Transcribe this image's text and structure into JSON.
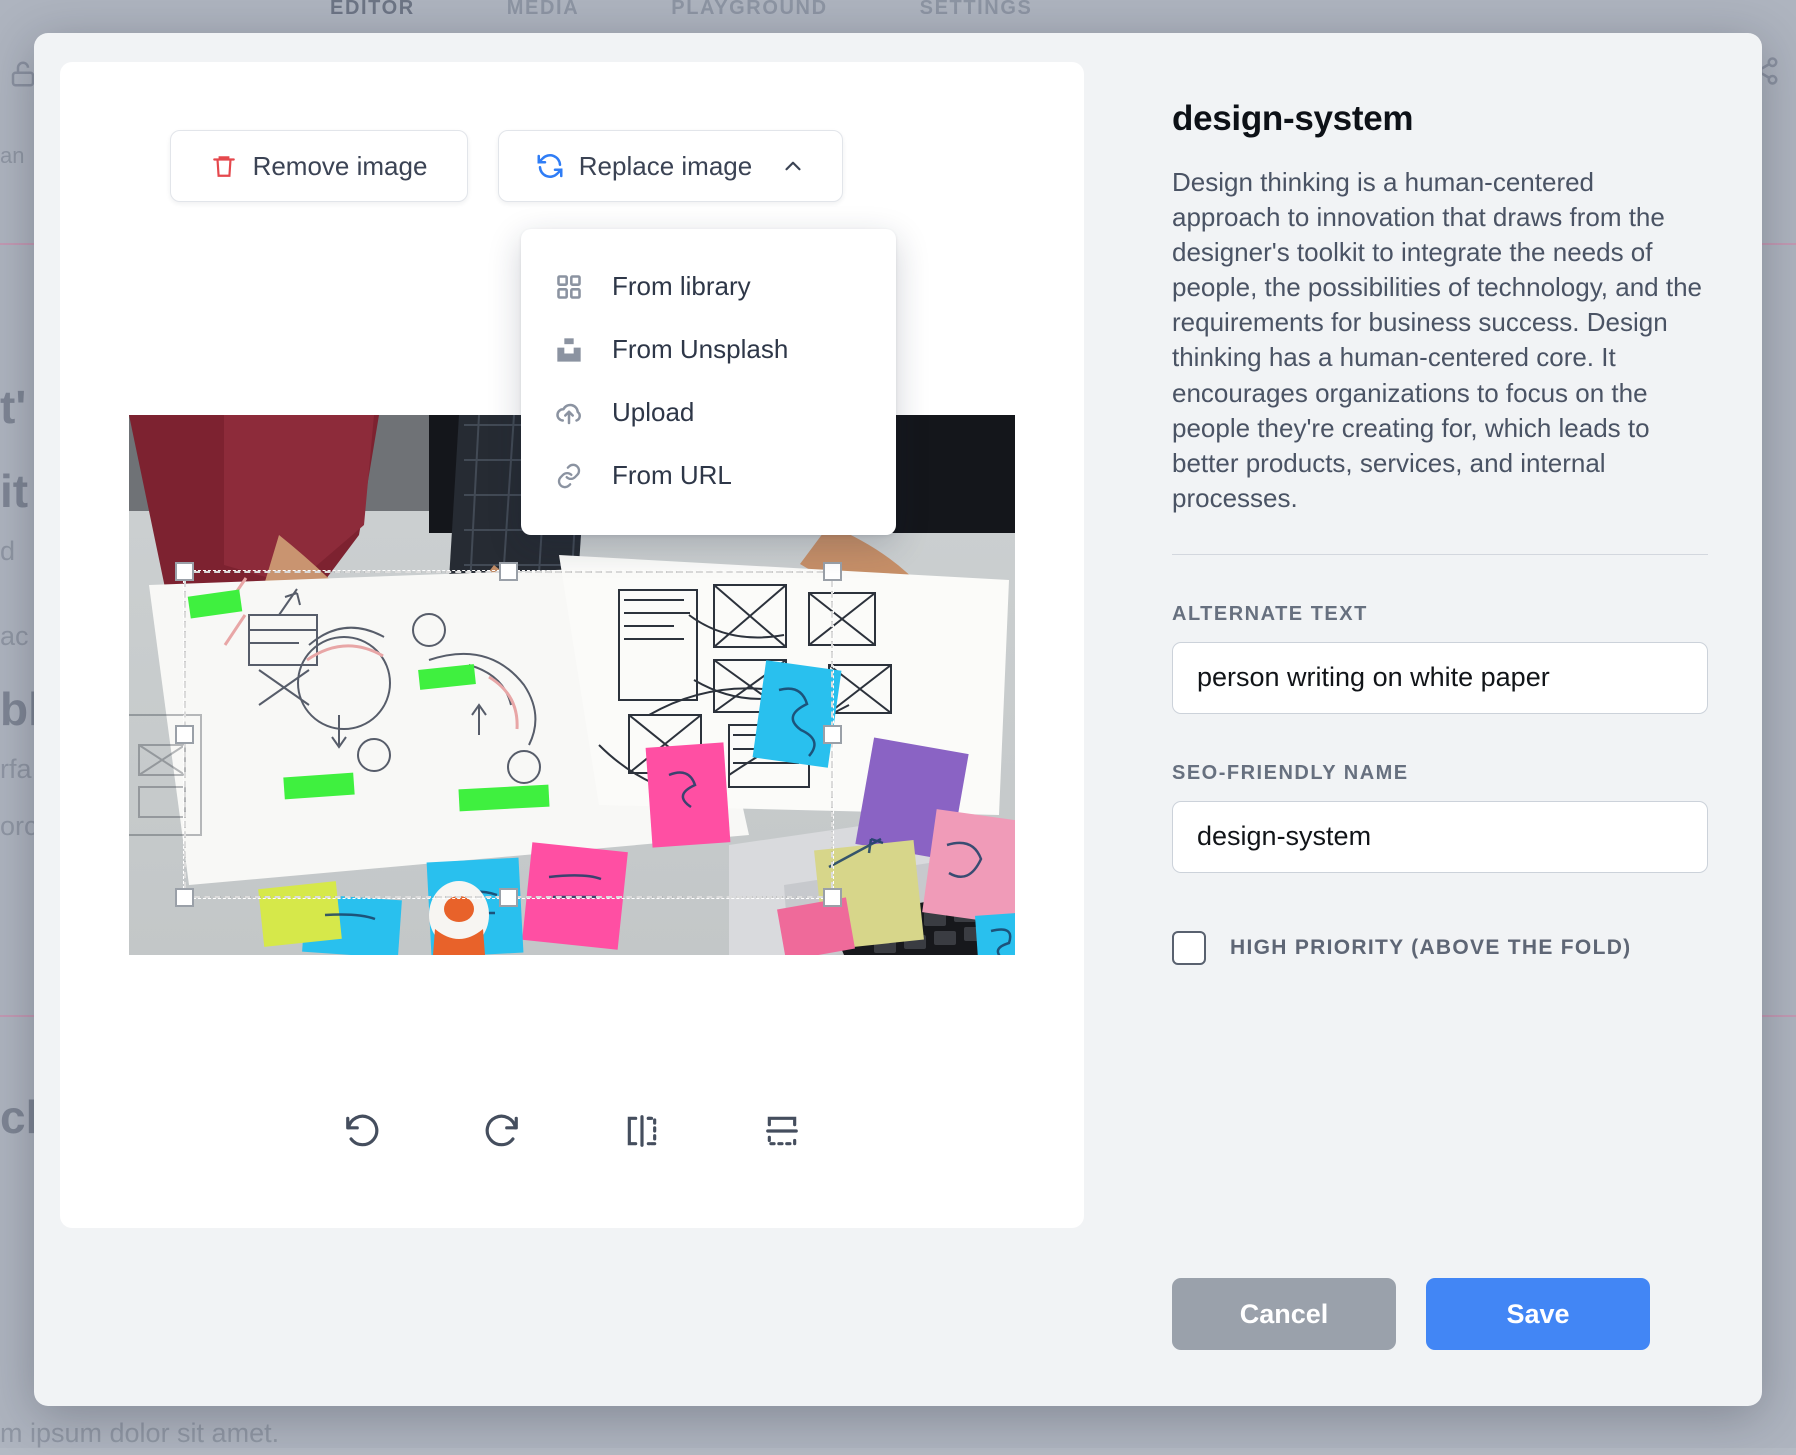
{
  "background": {
    "tabs": [
      {
        "label": "EDITOR",
        "active": true
      },
      {
        "label": "MEDIA",
        "active": false
      },
      {
        "label": "PLAYGROUND",
        "active": false
      },
      {
        "label": "SETTINGS",
        "active": false
      }
    ],
    "lock_icon": "unlock-icon",
    "share_icon": "share-icon",
    "fragments": {
      "line_an": "an",
      "heading_1": "t'",
      "heading_2": "it",
      "body_1": "d",
      "body_2": "ac",
      "body_3": "bl",
      "body_4": "rfa",
      "body_5": "orc",
      "heading_3": "ck",
      "footer": "m ipsum dolor sit amet."
    }
  },
  "editor": {
    "remove_label": "Remove image",
    "remove_icon": "trash-icon",
    "replace_label": "Replace image",
    "replace_icon": "refresh-icon",
    "replace_caret_icon": "chevron-up-icon",
    "menu_items": [
      {
        "label": "From library",
        "icon": "grid-icon"
      },
      {
        "label": "From Unsplash",
        "icon": "unsplash-icon"
      },
      {
        "label": "Upload",
        "icon": "cloud-upload-icon"
      },
      {
        "label": "From URL",
        "icon": "link-icon"
      }
    ],
    "transform_tools": [
      {
        "name": "rotate-left",
        "icon": "rotate-left-icon"
      },
      {
        "name": "rotate-right",
        "icon": "rotate-right-icon"
      },
      {
        "name": "flip-horizontal",
        "icon": "flip-horizontal-icon"
      },
      {
        "name": "flip-vertical",
        "icon": "flip-vertical-icon"
      }
    ],
    "image_alt": "Overhead view of a design thinking workshop: hands sketching wireframes on white paper with colored sticky notes and a laptop"
  },
  "panel": {
    "title": "design-system",
    "description": "Design thinking is a human-centered approach to innovation that draws from the designer's toolkit to integrate the needs of people, the possibilities of technology, and the requirements for business success. Design thinking has a human-centered core. It encourages organizations to focus on the people they're creating for, which leads to better products, services, and internal processes.",
    "alt_text_label": "ALTERNATE TEXT",
    "alt_text_value": "person writing on white paper",
    "seo_name_label": "SEO-FRIENDLY NAME",
    "seo_name_value": "design-system",
    "priority_label": "HIGH PRIORITY (ABOVE THE FOLD)",
    "priority_checked": false,
    "cancel_label": "Cancel",
    "save_label": "Save"
  },
  "colors": {
    "accent_blue": "#4286f5",
    "cancel_gray": "#9aa1ab",
    "danger_red": "#e5484d",
    "modal_bg": "#f1f3f5",
    "backdrop": "#aeb4bf"
  }
}
